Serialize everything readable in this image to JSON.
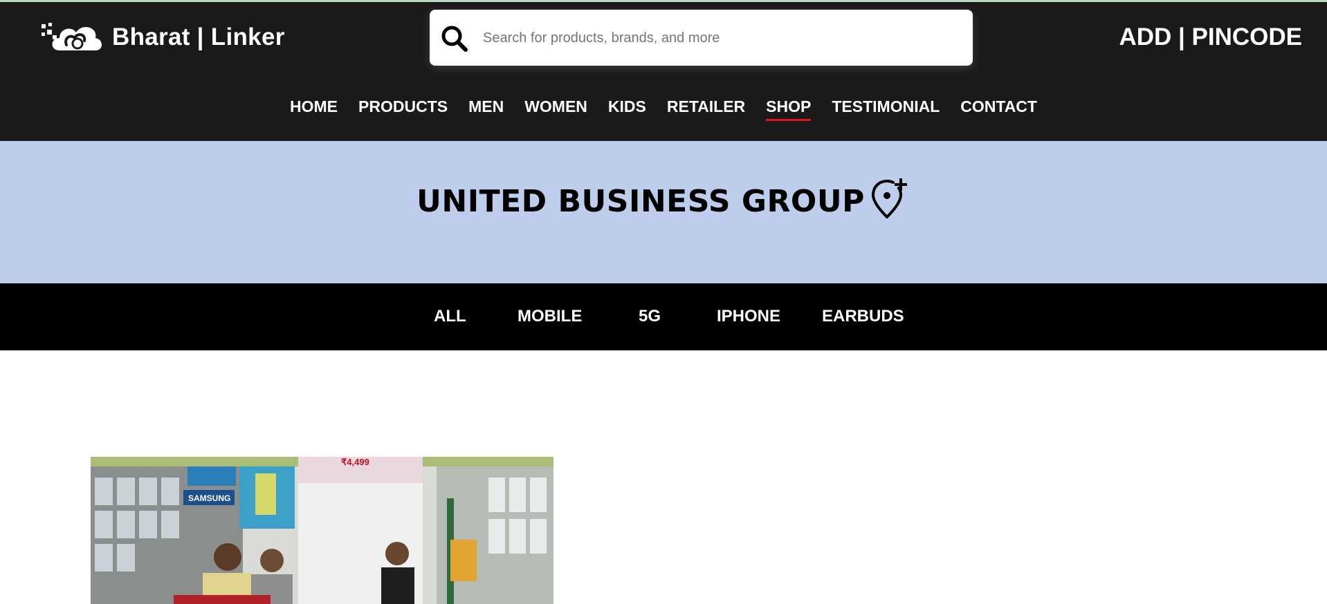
{
  "brand": {
    "name": "Bharat | Linker"
  },
  "search": {
    "placeholder": "Search for products, brands, and more"
  },
  "header": {
    "pincode_label": "ADD | PINCODE"
  },
  "nav": {
    "items": [
      {
        "label": "HOME"
      },
      {
        "label": "PRODUCTS"
      },
      {
        "label": "MEN"
      },
      {
        "label": "WOMEN"
      },
      {
        "label": "KIDS"
      },
      {
        "label": "RETAILER"
      },
      {
        "label": "SHOP",
        "active": true
      },
      {
        "label": "TESTIMONIAL"
      },
      {
        "label": "CONTACT"
      }
    ]
  },
  "shop": {
    "title": "UNITED BUSINESS GROUP",
    "location_icon": "add-location-icon"
  },
  "categories": [
    {
      "label": "ALL"
    },
    {
      "label": "MOBILE"
    },
    {
      "label": "5G"
    },
    {
      "label": "IPHONE"
    },
    {
      "label": "EARBUDS"
    }
  ],
  "photo": {
    "signs": {
      "brand": "SAMSUNG",
      "price": "₹4,499"
    }
  },
  "colors": {
    "header_bg": "#1b191a",
    "banner_bg": "#bdcdeb",
    "category_bar_bg": "#000000",
    "active_underline": "#e3161c"
  }
}
